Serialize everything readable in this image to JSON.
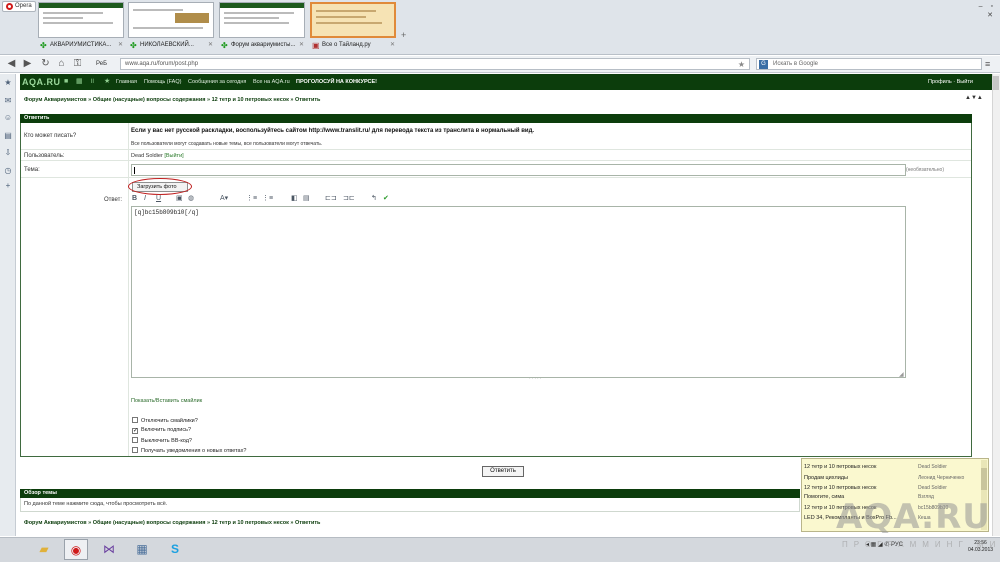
{
  "browser": {
    "opera_label": "Opera",
    "window_controls": "– ▫ ✕",
    "tabs": [
      {
        "label": "АКВАРИУМИСТИКА..."
      },
      {
        "label": "НИКОЛАЕВСКИЙ..."
      },
      {
        "label": "Форум аквариумисты..."
      },
      {
        "label": "Все о Тайланд.ру"
      }
    ],
    "new_tab": "+",
    "rb_badge": "РеБ",
    "address": "www.aqa.ru/forum/post.php",
    "search_engine": "G",
    "search_placeholder": "Искать в Google",
    "menu_icon": "≡"
  },
  "side_panel": {
    "icons": [
      "star-icon",
      "mail-icon",
      "contacts-icon",
      "notes-icon",
      "downloads-icon",
      "history-icon",
      "add-icon"
    ]
  },
  "site": {
    "logo": "AQA.RU",
    "nav": [
      "Главная",
      "Помощь (FAQ)",
      "Сообщения за сегодня",
      "Все на AQA.ru"
    ],
    "promo": "ПРОГОЛОСУЙ НА КОНКУРСЕ!",
    "user_links": "Профиль · Выйти",
    "breadcrumb": "Форум Аквариумистов » Общие (насущные) вопросы содержания » 12 тетр и 10 петровых несок » Ответить",
    "breadcrumb_arrows": "▲▼▲"
  },
  "form": {
    "title": "Ответить",
    "who_label": "Кто может писать?",
    "who_line1": "Если у вас нет русской раскладки, воспользуйтесь сайтом http://www.translit.ru/ для перевода текста из транслита в нормальный вид.",
    "who_line2": "Все пользователи могут создавать новые темы, все пользователи могут отвечать.",
    "user_label": "Пользователь:",
    "user_name": "Dead Soldier",
    "user_action": "[Выйти]",
    "subject_label": "Тема:",
    "subject_value": "",
    "subject_hint": "(необязательно)",
    "upload_label": "Загрузить фото",
    "message_label": "Ответ:",
    "toolbar": [
      "B",
      "I",
      "U",
      "▣",
      "◍",
      "A▾",
      "⋮≡",
      "⋮≡",
      "◧",
      "▤",
      "⊏⊐",
      "⊐⊏",
      "↰",
      "✔"
    ],
    "message_text": "[q]bc15b809b10[/q]",
    "smiles_link": "Показать/Вставить смайлик",
    "options": [
      {
        "label": "Отключить смайлики?",
        "checked": false
      },
      {
        "label": "Включить подпись?",
        "checked": true
      },
      {
        "label": "Выключить BB-код?",
        "checked": false
      },
      {
        "label": "Получать уведомления о новых ответах?",
        "checked": false
      }
    ],
    "submit_label": "Ответить"
  },
  "review": {
    "title": "Обзор темы",
    "text": "По данной теме нажмите сюда, чтобы просмотреть всё.",
    "breadcrumb": "Форум Аквариумистов » Общие (насущные) вопросы содержания » 12 тетр и 10 петровых несок » Ответить"
  },
  "notifications": [
    {
      "title": "12 тетр и 10 петровых несок",
      "sub": "Dead Soldier"
    },
    {
      "title": "Продам цихлиды",
      "sub": "Леонид Черниченко"
    },
    {
      "title": "12 тетр и 10 петровых несок",
      "sub": "Dead Soldier"
    },
    {
      "title": "Помогите, сима",
      "sub": "Взгляд"
    },
    {
      "title": "12 тетр и 10 петровых несок",
      "sub": "bc15b809b10"
    },
    {
      "title": "LED 34, Рекомпланты и BoxPro Fb...",
      "sub": "Кеша"
    }
  ],
  "taskbar": {
    "apps": [
      {
        "icon": "folder-icon",
        "glyph": "▰",
        "color": "#e0b13a"
      },
      {
        "icon": "opera-icon",
        "glyph": "◉",
        "color": "#d01a1a"
      },
      {
        "icon": "visual-studio-icon",
        "glyph": "⋈",
        "color": "#6a3f9f"
      },
      {
        "icon": "calculator-icon",
        "glyph": "▦",
        "color": "#4a6f9a"
      },
      {
        "icon": "skype-icon",
        "glyph": "S",
        "color": "#1aa0e0"
      }
    ],
    "tray": "◂ ▦ ◢ ✆  РУС",
    "time": "23:56",
    "date": "04.03.2013"
  },
  "watermark": {
    "main": "AQA.RU",
    "sub": "ПРОГРАММИНГ МИР"
  }
}
